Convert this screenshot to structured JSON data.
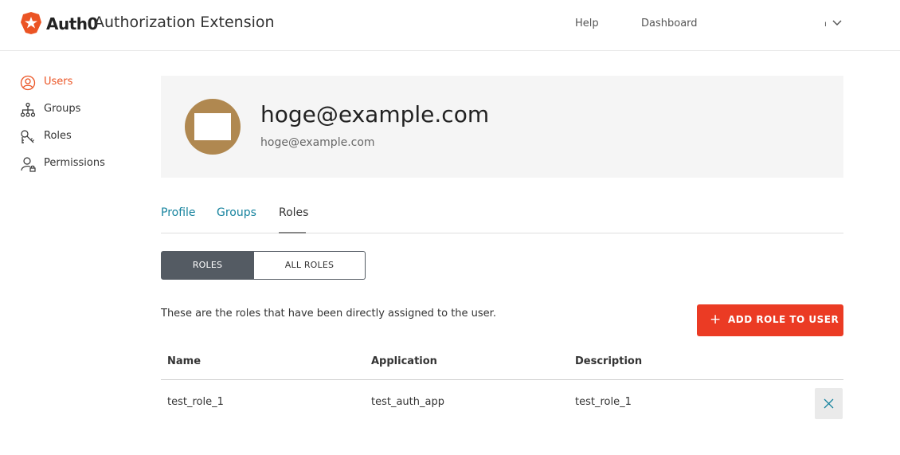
{
  "header": {
    "brand": "Auth0",
    "app_title": "Authorization Extension",
    "nav": {
      "help": "Help",
      "dashboard": "Dashboard"
    },
    "user_menu_label": "ı",
    "brand_color": "#eb5424"
  },
  "sidebar": {
    "items": [
      {
        "label": "Users",
        "icon": "user-circle-icon",
        "active": true
      },
      {
        "label": "Groups",
        "icon": "hierarchy-icon",
        "active": false
      },
      {
        "label": "Roles",
        "icon": "keys-icon",
        "active": false
      },
      {
        "label": "Permissions",
        "icon": "user-lock-icon",
        "active": false
      }
    ]
  },
  "profile": {
    "name": "hoge@example.com",
    "email": "hoge@example.com"
  },
  "tabs": [
    {
      "label": "Profile",
      "active": false
    },
    {
      "label": "Groups",
      "active": false
    },
    {
      "label": "Roles",
      "active": true
    }
  ],
  "segmented": {
    "roles": "ROLES",
    "all_roles": "ALL ROLES"
  },
  "roles_section": {
    "description": "These are the roles that have been directly assigned to the user.",
    "add_button": "ADD ROLE TO USER",
    "accent_color": "#eb3b24"
  },
  "table": {
    "headers": {
      "name": "Name",
      "application": "Application",
      "description": "Description"
    },
    "rows": [
      {
        "name": "test_role_1",
        "application": "test_auth_app",
        "description": "test_role_1"
      }
    ]
  }
}
